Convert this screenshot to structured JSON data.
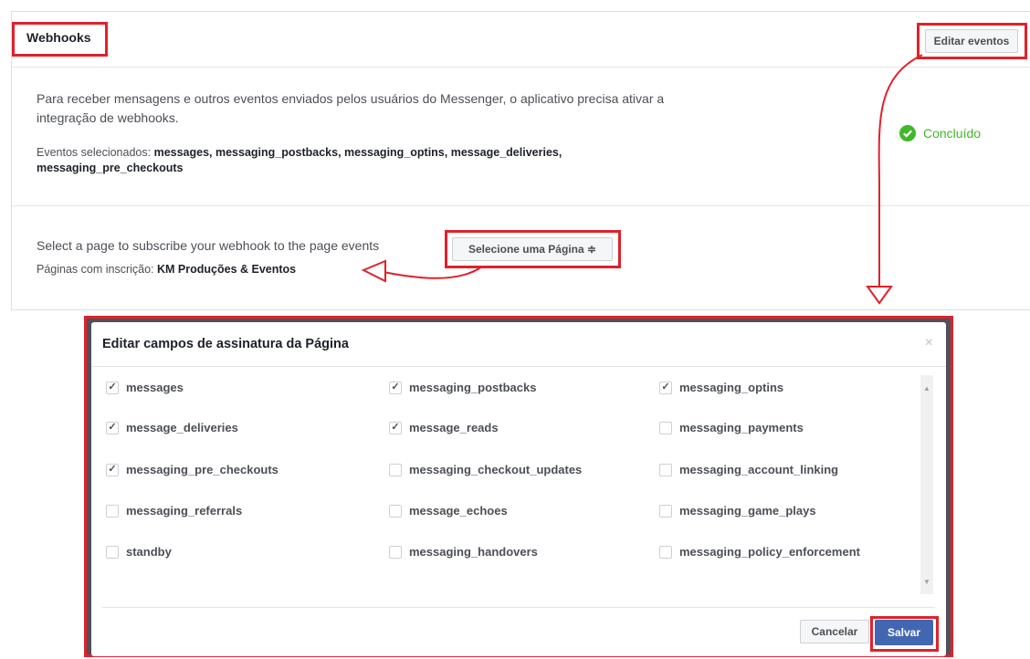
{
  "webhooks": {
    "title": "Webhooks",
    "edit_events_label": "Editar eventos",
    "description": "Para receber mensagens e outros eventos enviados pelos usuários do Messenger, o aplicativo precisa ativar a integração de webhooks.",
    "selected_events_label": "Eventos selecionados:",
    "selected_events": "messages, messaging_postbacks, messaging_optins, message_deliveries, messaging_pre_checkouts",
    "status_label": "Concluído",
    "subscribe_text": "Select a page to subscribe your webhook to the page events",
    "page_select_label": "Selecione uma Página ≑",
    "subscribed_pages_label": "Páginas com inscrição:",
    "subscribed_page": "KM Produções & Eventos"
  },
  "colors": {
    "annotation_red": "#e0212b",
    "success_green": "#42b72a",
    "primary_blue": "#4267b2"
  },
  "modal": {
    "title": "Editar campos de assinatura da Página",
    "close_icon": "×",
    "fields": [
      {
        "label": "messages",
        "checked": true
      },
      {
        "label": "messaging_postbacks",
        "checked": true
      },
      {
        "label": "messaging_optins",
        "checked": true
      },
      {
        "label": "message_deliveries",
        "checked": true
      },
      {
        "label": "message_reads",
        "checked": true
      },
      {
        "label": "messaging_payments",
        "checked": false
      },
      {
        "label": "messaging_pre_checkouts",
        "checked": true
      },
      {
        "label": "messaging_checkout_updates",
        "checked": false
      },
      {
        "label": "messaging_account_linking",
        "checked": false
      },
      {
        "label": "messaging_referrals",
        "checked": false
      },
      {
        "label": "message_echoes",
        "checked": false
      },
      {
        "label": "messaging_game_plays",
        "checked": false
      },
      {
        "label": "standby",
        "checked": false
      },
      {
        "label": "messaging_handovers",
        "checked": false
      },
      {
        "label": "messaging_policy_enforcement",
        "checked": false
      }
    ],
    "cancel_label": "Cancelar",
    "save_label": "Salvar"
  }
}
